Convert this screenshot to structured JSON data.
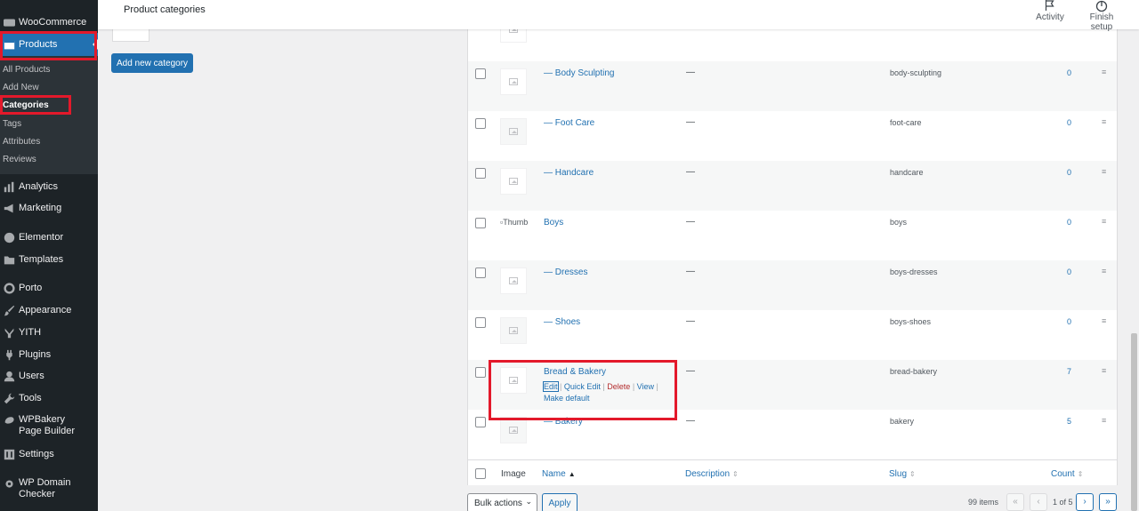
{
  "sidebar": {
    "woocommerce": "WooCommerce",
    "products": "Products",
    "submenu": [
      "All Products",
      "Add New",
      "Categories",
      "Tags",
      "Attributes",
      "Reviews"
    ],
    "menu": [
      "Analytics",
      "Marketing",
      "Elementor",
      "Templates",
      "Porto",
      "Appearance",
      "YITH",
      "Plugins",
      "Users",
      "Tools",
      "WPBakery Page Builder",
      "Settings",
      "WP Domain Checker"
    ]
  },
  "topbar": {
    "title": "Product categories",
    "activity": "Activity",
    "finish_setup": "Finish setup"
  },
  "form": {
    "add_button": "Add new category"
  },
  "table": {
    "rows": [
      {
        "name": "— Body Sculpting",
        "description": "—",
        "slug": "body-sculpting",
        "count": "0"
      },
      {
        "name": "— Foot Care",
        "description": "—",
        "slug": "foot-care",
        "count": "0"
      },
      {
        "name": "— Handcare",
        "description": "—",
        "slug": "handcare",
        "count": "0"
      },
      {
        "name": "Boys",
        "description": "—",
        "slug": "boys",
        "count": "0",
        "broken_image": "Thumbnail"
      },
      {
        "name": "— Dresses",
        "description": "—",
        "slug": "boys-dresses",
        "count": "0"
      },
      {
        "name": "— Shoes",
        "description": "—",
        "slug": "boys-shoes",
        "count": "0"
      },
      {
        "name": "Bread & Bakery",
        "description": "—",
        "slug": "bread-bakery",
        "count": "7"
      },
      {
        "name": "— Bakery",
        "description": "—",
        "slug": "bakery",
        "count": "5"
      }
    ],
    "row_actions": {
      "edit": "Edit",
      "quick_edit": "Quick Edit",
      "delete": "Delete",
      "view": "View",
      "make_default": "Make default",
      "separator": "|"
    },
    "columns": {
      "image": "Image",
      "name": "Name",
      "description": "Description",
      "slug": "Slug",
      "count": "Count"
    }
  },
  "bulk": {
    "select": "Bulk actions",
    "apply": "Apply"
  },
  "pagination": {
    "items": "99 items",
    "page_info": "1 of 5",
    "first": "«",
    "prev": "‹",
    "next": "›",
    "last": "»"
  },
  "colors": {
    "accent": "#2271b1",
    "sidebar": "#1d2327",
    "highlight": "#e3192b",
    "delete": "#b32d2e"
  }
}
